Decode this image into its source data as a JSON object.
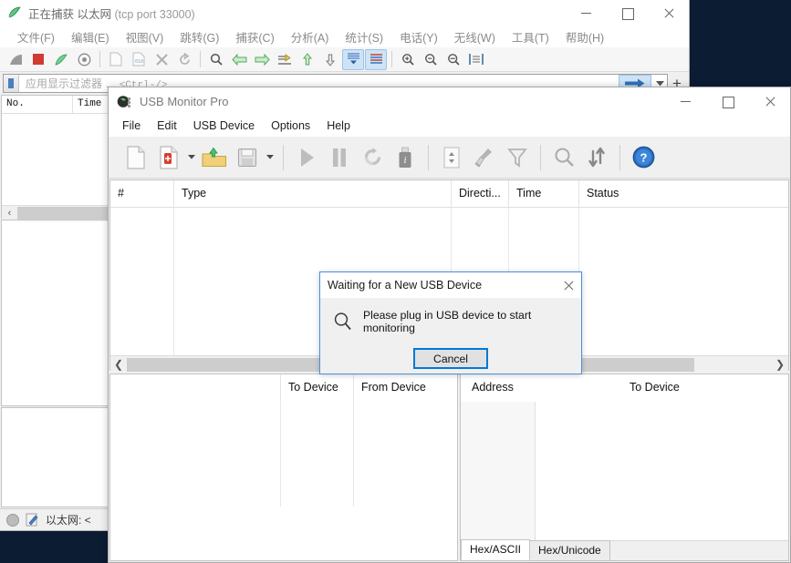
{
  "wireshark": {
    "title_main": "正在捕获 以太网",
    "title_suffix": "(tcp port 33000)",
    "icon": "wireshark-fin-icon",
    "menu": [
      {
        "label": "文件(F)",
        "name": "menu-file"
      },
      {
        "label": "编辑(E)",
        "name": "menu-edit"
      },
      {
        "label": "视图(V)",
        "name": "menu-view"
      },
      {
        "label": "跳转(G)",
        "name": "menu-go"
      },
      {
        "label": "捕获(C)",
        "name": "menu-capture"
      },
      {
        "label": "分析(A)",
        "name": "menu-analyze"
      },
      {
        "label": "统计(S)",
        "name": "menu-statistics"
      },
      {
        "label": "电话(Y)",
        "name": "menu-telephony"
      },
      {
        "label": "无线(W)",
        "name": "menu-wireless"
      },
      {
        "label": "工具(T)",
        "name": "menu-tools"
      },
      {
        "label": "帮助(H)",
        "name": "menu-help"
      }
    ],
    "toolbar_icons": [
      "start-capture-icon",
      "stop-capture-icon",
      "restart-capture-icon",
      "capture-options-icon",
      "open-file-icon",
      "save-file-icon",
      "close-file-icon",
      "reload-file-icon",
      "find-packet-icon",
      "go-back-icon",
      "go-forward-icon",
      "go-to-packet-icon",
      "go-first-packet-icon",
      "go-last-packet-icon",
      "auto-scroll-icon",
      "colorize-icon",
      "zoom-in-icon",
      "zoom-out-icon",
      "zoom-reset-icon",
      "resize-columns-icon"
    ],
    "filter": {
      "placeholder": "应用显示过滤器",
      "hint_dots": "…",
      "hint_shortcut": "<Ctrl-/>",
      "value": "",
      "bookmark_icon": "filter-bookmark-icon",
      "apply_icon": "apply-filter-arrow-icon",
      "dropdown_icon": "chevron-down-icon",
      "add_icon": "add-filter-button"
    },
    "packet_columns": [
      "No.",
      "Time"
    ],
    "statusbar": {
      "capture_icon": "capture-status-circle-icon",
      "notes_icon": "expert-info-icon",
      "text": "以太网: <"
    },
    "window_controls": {
      "minimize": "minimize-icon",
      "maximize": "maximize-icon",
      "close": "close-icon"
    }
  },
  "usbmonitor": {
    "title": "USB Monitor Pro",
    "icon": "usb-monitor-app-icon",
    "menu": [
      {
        "label": "File",
        "name": "menu-file"
      },
      {
        "label": "Edit",
        "name": "menu-edit"
      },
      {
        "label": "USB Device",
        "name": "menu-usb-device"
      },
      {
        "label": "Options",
        "name": "menu-options"
      },
      {
        "label": "Help",
        "name": "menu-help"
      }
    ],
    "toolbar": [
      {
        "name": "new-session-icon",
        "label": "New"
      },
      {
        "name": "new-monitor-icon",
        "label": "New Monitor"
      },
      {
        "name": "open-folder-icon",
        "label": "Open"
      },
      {
        "name": "save-icon",
        "label": "Save"
      },
      {
        "name": "start-icon",
        "label": "Start"
      },
      {
        "name": "pause-icon",
        "label": "Pause"
      },
      {
        "name": "refresh-icon",
        "label": "Refresh"
      },
      {
        "name": "usb-info-icon",
        "label": "Device Info"
      },
      {
        "name": "page-setup-icon",
        "label": "Properties"
      },
      {
        "name": "clear-broom-icon",
        "label": "Clear"
      },
      {
        "name": "filter-funnel-icon",
        "label": "Filter"
      },
      {
        "name": "search-icon",
        "label": "Search"
      },
      {
        "name": "sort-icon",
        "label": "Sort"
      },
      {
        "name": "help-icon",
        "label": "Help"
      }
    ],
    "list_columns": [
      "#",
      "Type",
      "Directi...",
      "Time",
      "Status"
    ],
    "list_rows": [],
    "left_panel_columns": [
      "",
      "To Device",
      "From Device"
    ],
    "right_panel_columns": [
      "Address",
      "To Device"
    ],
    "tabs": [
      {
        "label": "Hex/ASCII",
        "active": true
      },
      {
        "label": "Hex/Unicode",
        "active": false
      }
    ],
    "window_controls": {
      "minimize": "minimize-icon",
      "maximize": "maximize-icon",
      "close": "close-icon"
    }
  },
  "dialog": {
    "title": "Waiting for a New USB Device",
    "message": "Please plug in USB device to start monitoring",
    "icon": "magnifier-icon",
    "cancel_label": "Cancel",
    "close_icon": "close-icon",
    "accent_color": "#0078d7"
  },
  "desktop": {
    "background_color": "#0b1c33"
  }
}
